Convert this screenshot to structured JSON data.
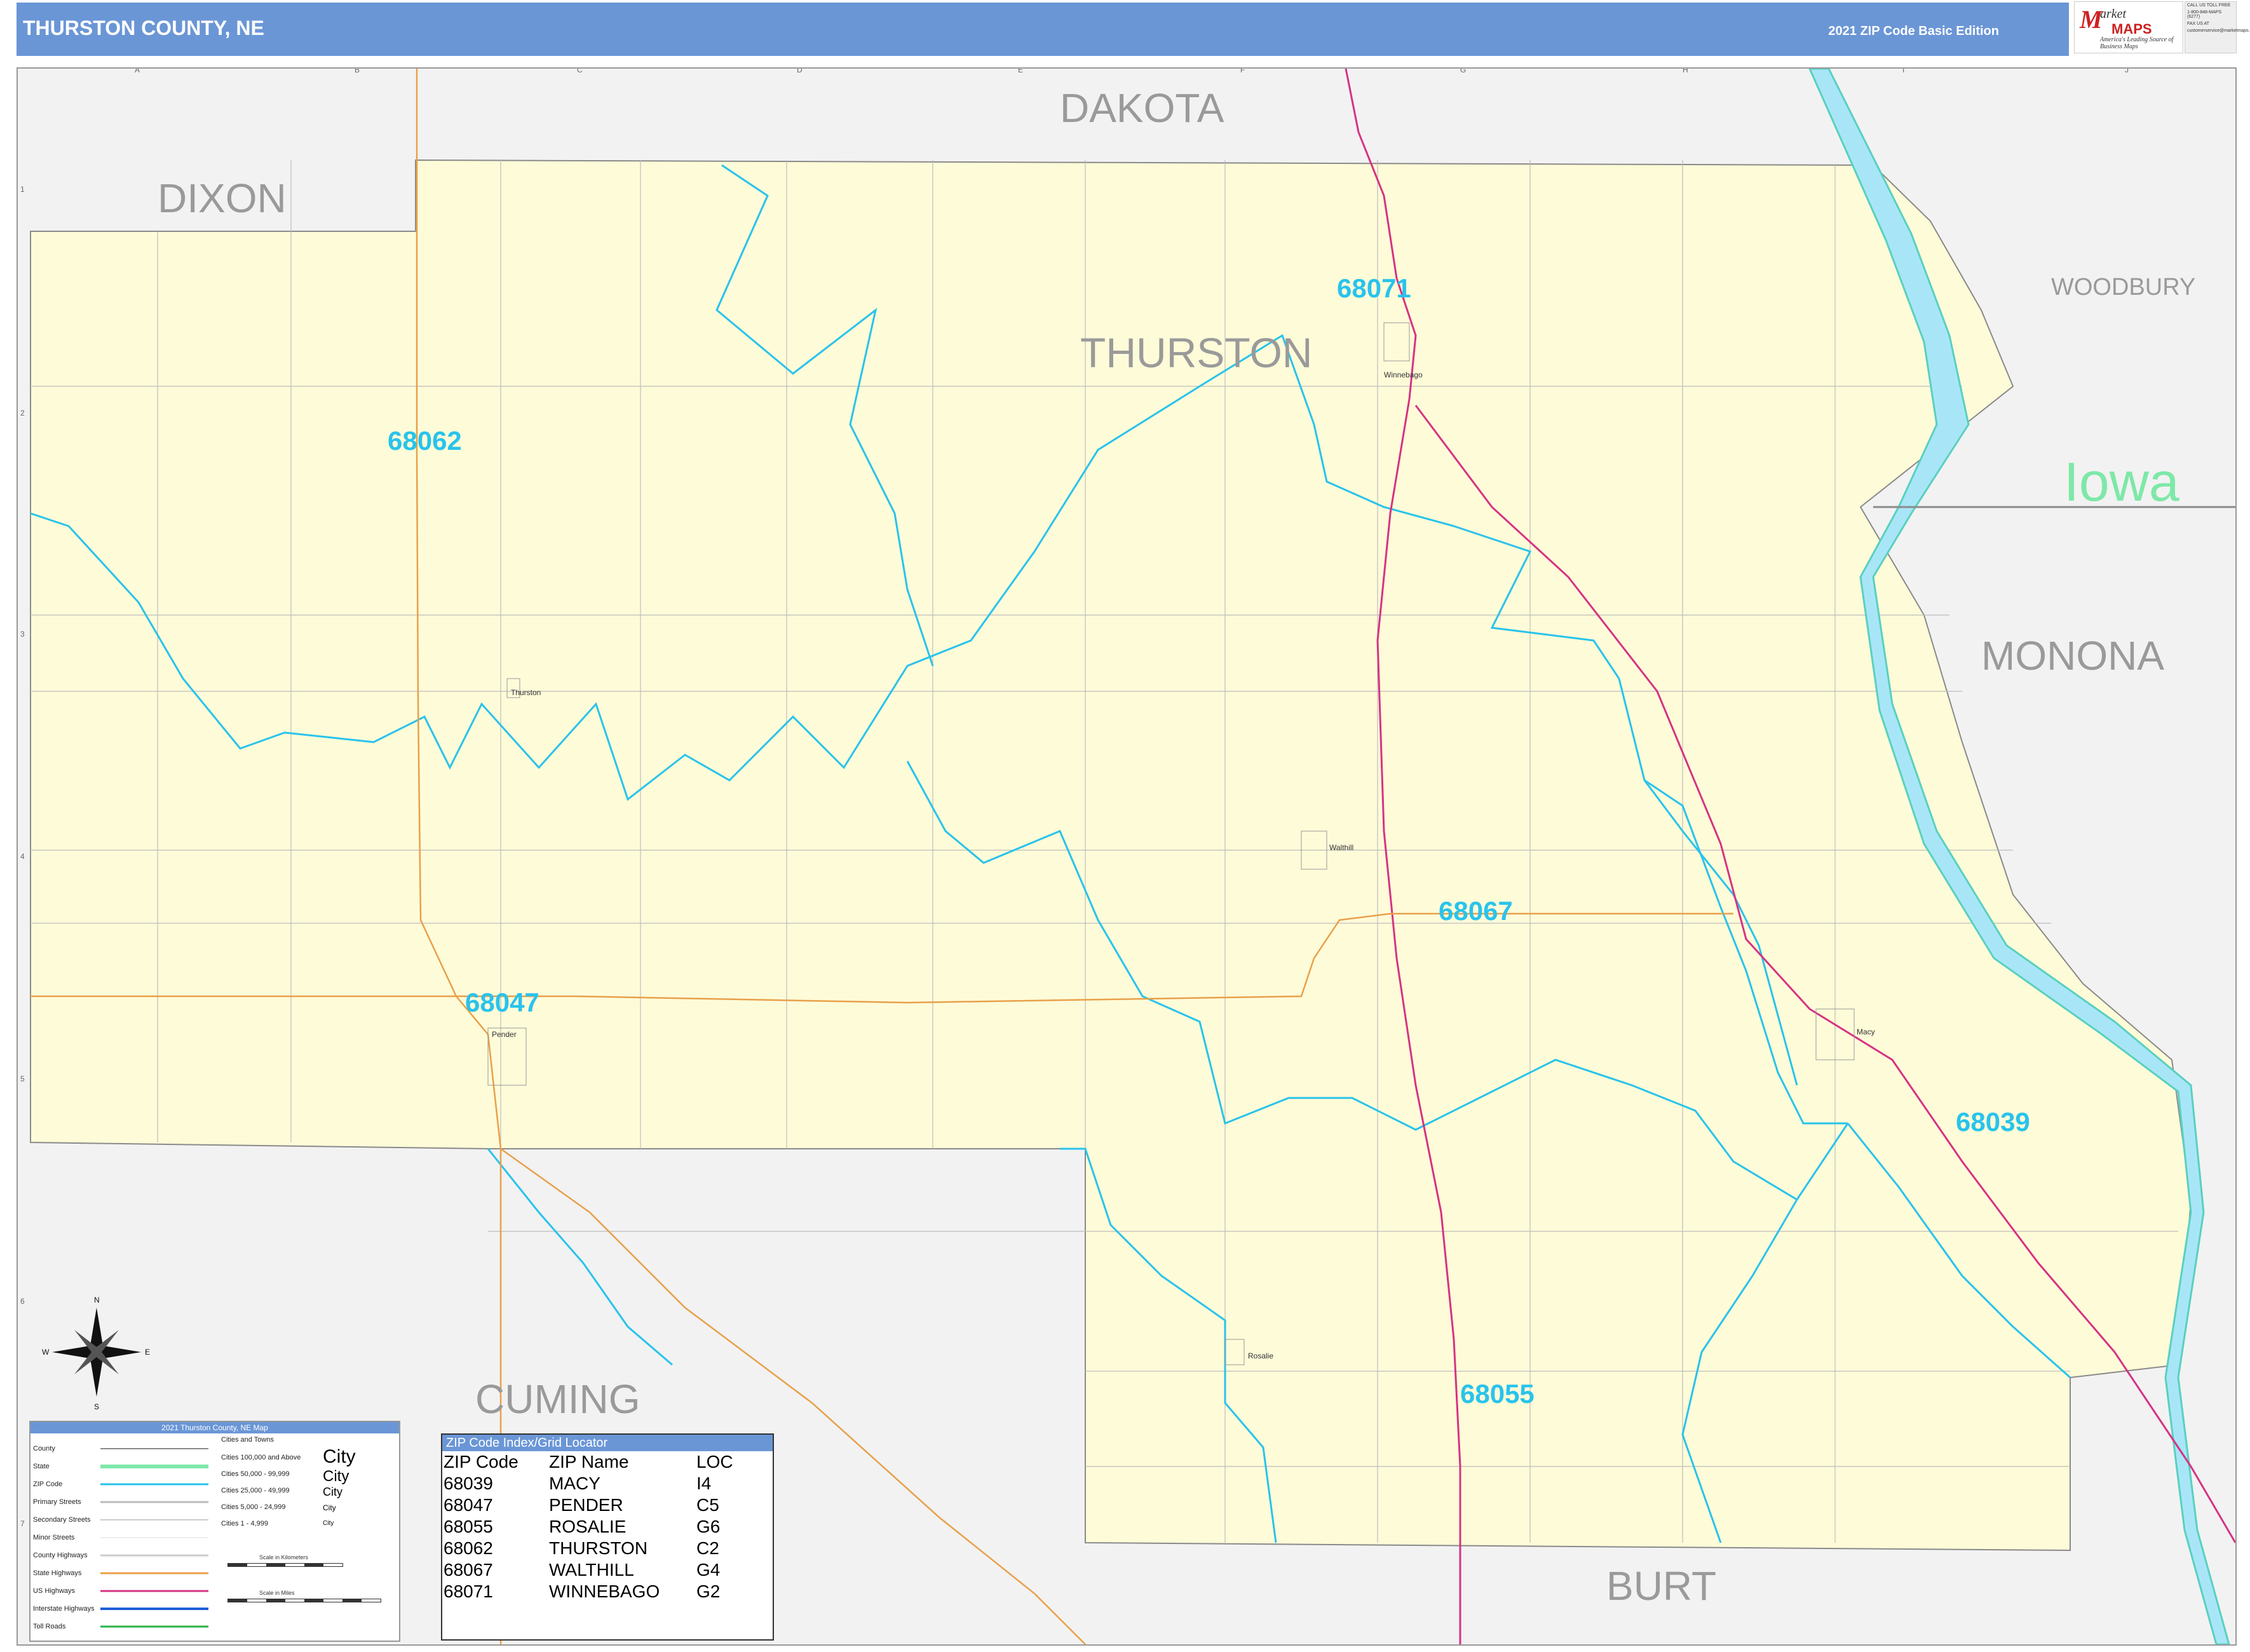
{
  "header": {
    "title": "THURSTON COUNTY, NE",
    "edition": "2021 ZIP Code Basic Edition"
  },
  "logo": {
    "mark": "M",
    "word1": "arket",
    "word2": "MAPS",
    "tagline": "America's Leading Source of Business Maps"
  },
  "contact": {
    "line1": "CALL US TOLL FREE",
    "line2": "1-800-848-MAPS (6277)",
    "line3": "FAX US AT",
    "line4": "customerservice@marketmaps.com"
  },
  "map": {
    "county_name": "THURSTON",
    "state_label": "Iowa",
    "neighbors": [
      "DIXON",
      "DAKOTA",
      "WOODBURY",
      "MONONA",
      "BURT",
      "CUMING"
    ],
    "zip_labels": [
      "68071",
      "68062",
      "68067",
      "68047",
      "68039",
      "68055"
    ],
    "towns": [
      "Winnebago",
      "Thurston",
      "Walthill",
      "Pender",
      "Macy",
      "Rosalie"
    ],
    "grid_columns": [
      "A",
      "B",
      "C",
      "D",
      "E",
      "F",
      "G",
      "H",
      "I",
      "J"
    ],
    "grid_rows": [
      "1",
      "2",
      "3",
      "4",
      "5",
      "6",
      "7"
    ],
    "compass": [
      "N",
      "E",
      "S",
      "W"
    ],
    "colors": {
      "county_fill": "#fefbd8",
      "outside_fill": "#f2f2f2",
      "zip_boundary": "#29c3ec",
      "water": "#a8e6f7",
      "us_highway": "#d63384",
      "county_highway": "#e8a04a",
      "state_border": "#8a8a8a"
    }
  },
  "legend": {
    "title": "2021 Thurston County, NE Map",
    "rows": [
      "County",
      "State",
      "ZIP Code",
      "Primary Streets",
      "Secondary Streets",
      "Minor Streets",
      "County Highways",
      "State Highways",
      "US Highways",
      "Interstate Highways",
      "Toll Roads"
    ],
    "city_header": "Cities and Towns",
    "city_rows": [
      "Cities 100,000 and Above",
      "Cities 50,000 - 99,999",
      "Cities 25,000 - 49,999",
      "Cities 5,000 - 24,999",
      "Cities 1 - 4,999"
    ],
    "city_samples": [
      "City",
      "City",
      "City",
      "City",
      "City"
    ],
    "scale_km": "Scale in Kilometers",
    "scale_mi": "Scale in Miles"
  },
  "zip_index": {
    "title": "ZIP Code Index/Grid Locator",
    "headers": [
      "ZIP Code",
      "ZIP Name",
      "LOC"
    ],
    "rows": [
      [
        "68039",
        "MACY",
        "I4"
      ],
      [
        "68047",
        "PENDER",
        "C5"
      ],
      [
        "68055",
        "ROSALIE",
        "G6"
      ],
      [
        "68062",
        "THURSTON",
        "C2"
      ],
      [
        "68067",
        "WALTHILL",
        "G4"
      ],
      [
        "68071",
        "WINNEBAGO",
        "G2"
      ]
    ]
  }
}
